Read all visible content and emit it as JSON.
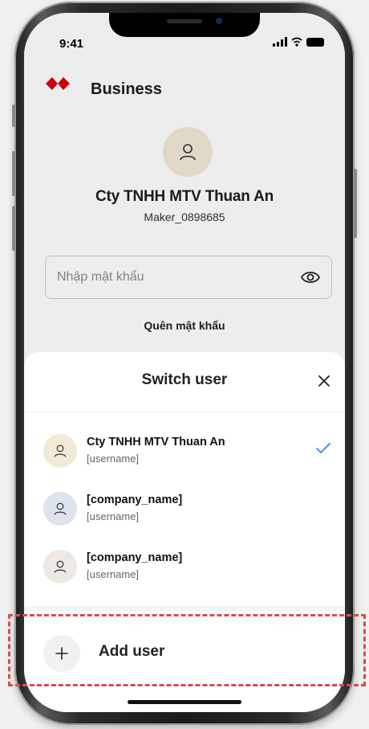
{
  "status_bar": {
    "time": "9:41"
  },
  "app": {
    "business_title": "Business",
    "company_name": "Cty TNHH MTV Thuan An",
    "maker_id": "Maker_0898685",
    "password_placeholder": "Nhập mật khẩu",
    "forgot_password": "Quên mật khẩu",
    "brand_color": "#db0011"
  },
  "switch_user_sheet": {
    "title": "Switch user",
    "users": [
      {
        "name": "Cty TNHH MTV Thuan An",
        "username": "[username]",
        "selected": true,
        "avatar_color": "#f1ead7"
      },
      {
        "name": "[company_name]",
        "username": "[username]",
        "selected": false,
        "avatar_color": "#dde4ee"
      },
      {
        "name": "[company_name]",
        "username": "[username]",
        "selected": false,
        "avatar_color": "#ede8e2"
      }
    ],
    "add_user_label": "Add user",
    "check_color": "#3b82f6"
  },
  "annotation": {
    "highlight_color": "#dc4a4a"
  }
}
